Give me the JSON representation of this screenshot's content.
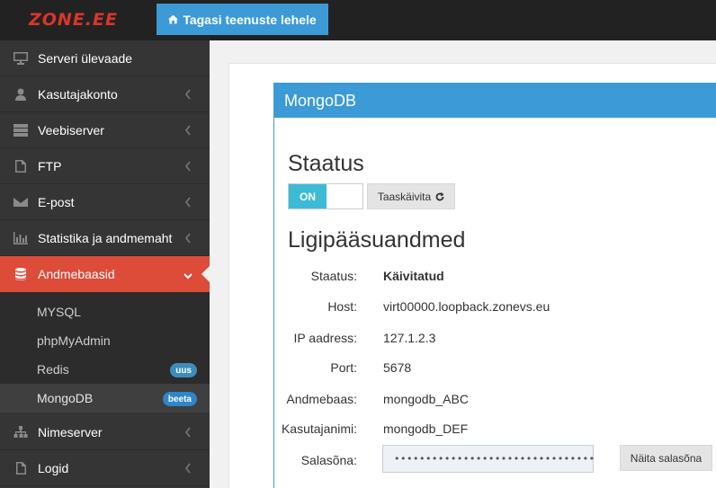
{
  "header": {
    "logo_text": "ZONE.EE",
    "back_button_label": "Tagasi teenuste lehele"
  },
  "sidebar": {
    "items": [
      {
        "label": "Serveri ülevaade",
        "icon": "monitor-icon",
        "has_chevron": false
      },
      {
        "label": "Kasutajakonto",
        "icon": "user-icon",
        "has_chevron": true
      },
      {
        "label": "Veebiserver",
        "icon": "server-icon",
        "has_chevron": true
      },
      {
        "label": "FTP",
        "icon": "file-code-icon",
        "has_chevron": true
      },
      {
        "label": "E-post",
        "icon": "envelope-icon",
        "has_chevron": true
      },
      {
        "label": "Statistika ja andmemaht",
        "icon": "bar-chart-icon",
        "has_chevron": true
      },
      {
        "label": "Andmebaasid",
        "icon": "database-icon",
        "has_chevron": true,
        "active": true
      },
      {
        "label": "Nimeserver",
        "icon": "sitemap-icon",
        "has_chevron": true
      },
      {
        "label": "Logid",
        "icon": "file-icon",
        "has_chevron": true
      }
    ],
    "submenu": [
      {
        "label": "MYSQL"
      },
      {
        "label": "phpMyAdmin"
      },
      {
        "label": "Redis",
        "badge": "uus"
      },
      {
        "label": "MongoDB",
        "badge": "beeta",
        "current": true
      }
    ]
  },
  "panel": {
    "title": "MongoDB",
    "status_heading": "Staatus",
    "toggle_label": "ON",
    "restart_label": "Taaskäivita",
    "credentials_heading": "Ligipääsuandmed",
    "fields": [
      {
        "label": "Staatus:",
        "value": "Käivitatud"
      },
      {
        "label": "Host:",
        "value": "virt00000.loopback.zonevs.eu"
      },
      {
        "label": "IP aadress:",
        "value": "127.1.2.3"
      },
      {
        "label": "Port:",
        "value": "5678"
      },
      {
        "label": "Andmebaas:",
        "value": "mongodb_ABC"
      },
      {
        "label": "Kasutajanimi:",
        "value": "mongodb_DEF"
      }
    ],
    "password_label": "Salasõna:",
    "password_masked": "••••••••••••••••••••••••••••••••",
    "show_password_label": "Näita salasõna"
  },
  "colors": {
    "accent_blue": "#3c9ad6",
    "active_red": "#dd4b39",
    "toggle_cyan": "#3dbbd6",
    "sidebar_bg": "#353535",
    "topbar_bg": "#222222"
  }
}
